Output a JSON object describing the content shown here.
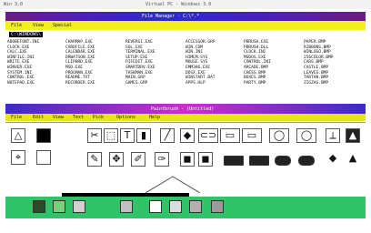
{
  "screen": {
    "top_left_text": "Win 3.0",
    "top_center_text": "Virtual PC - Windows 3.0"
  },
  "file_manager": {
    "title": "File Manager - C:\\*.*",
    "menu": [
      "File",
      "View",
      "Special"
    ],
    "path_row": "C:\\WINDOWS\\",
    "columns": [
      [
        "ADOBEFONT.INI",
        "CLOCK.EXE",
        "CALC.EXE",
        "WINFILE.INI",
        "WRITE.EXE",
        "WINVER.EXE",
        "SYSTEM.INI",
        "CONTROL.EXE",
        "NOTEPAD.EXE"
      ],
      [
        "CHARMAP.EXE",
        "CARDFILE.EXE",
        "CALENDAR.EXE",
        "DRWATSON.EXE",
        "CLIPBRD.EXE",
        "MSD.EXE",
        "PROGMAN.EXE",
        "README.TXT",
        "RECORDER.EXE"
      ],
      [
        "REVERSI.EXE",
        "SOL.EXE",
        "TERMINAL.EXE",
        "SETUP.EXE",
        "PIFEDIT.EXE",
        "SMARTDRV.EXE",
        "TASKMAN.EXE",
        "MAIN.GRP",
        "GAMES.GRP"
      ],
      [
        "ACCESSOR.GRP",
        "WIN.COM",
        "WIN.INI",
        "HIMEM.SYS",
        "MOUSE.SYS",
        "EMM386.EXE",
        "DOSX.EXE",
        "WINSTART.BAT",
        "APPS.HLP"
      ],
      [
        "PBRUSH.EXE",
        "PBRUSH.DLL",
        "CLOCK.INI",
        "MSDOS.EXE",
        "CONTROL.INI",
        "ARCADE.BMP",
        "CHESS.BMP",
        "BOXES.BMP",
        "PARTY.BMP"
      ],
      [
        "PAPER.BMP",
        "RIBBONS.BMP",
        "WINLOGO.BMP",
        "256COLOR.BMP",
        "CARS.BMP",
        "CASTLE.BMP",
        "LEAVES.BMP",
        "TARTAN.BMP",
        "ZIGZAG.BMP"
      ]
    ]
  },
  "paintbrush": {
    "title": "Paintbrush - (Untitled)",
    "menu": [
      "File",
      "Edit",
      "View",
      "Text",
      "Pick",
      "Options",
      "Help"
    ],
    "tools_row1": [
      "✂",
      "⬚",
      "T",
      "▮",
      "╱",
      "◆",
      "⊂⊃",
      "▭",
      "▭",
      "◯",
      "◯",
      "⟂",
      "▲"
    ],
    "tools_row2": [
      "✎",
      "✥",
      "✐",
      "✑",
      "◼",
      "◼",
      "▬",
      "▬",
      "⬬",
      "⬬",
      "◆",
      "▲"
    ]
  },
  "taskbar": {
    "icons": [
      "disk-icon",
      "pencil-icon",
      "folder-icon",
      "paint-icon",
      "notepad-icon",
      "calc-icon",
      "printer-icon",
      "card-icon"
    ]
  }
}
